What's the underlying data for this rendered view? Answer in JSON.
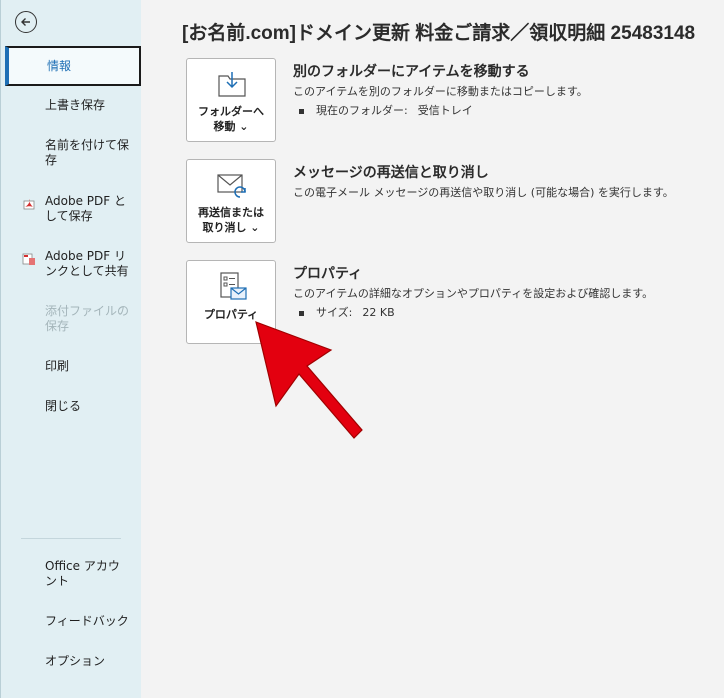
{
  "sidebar": {
    "items": [
      {
        "label": "情報"
      },
      {
        "label": "上書き保存"
      },
      {
        "label": "名前を付けて保存"
      },
      {
        "label": "Adobe PDF として保存"
      },
      {
        "label": "Adobe PDF リンクとして共有"
      },
      {
        "label": "添付ファイルの保存"
      },
      {
        "label": "印刷"
      },
      {
        "label": "閉じる"
      }
    ],
    "bottom_items": [
      {
        "label": "Office アカウント"
      },
      {
        "label": "フィードバック"
      },
      {
        "label": "オプション"
      }
    ]
  },
  "main": {
    "title": "[お名前.com]ドメイン更新 料金ご請求／領収明細 25483148",
    "sections": [
      {
        "button_line1": "フォルダーへ",
        "button_line2": "移動 ⌄",
        "title": "別のフォルダーにアイテムを移動する",
        "description": "このアイテムを別のフォルダーに移動またはコピーします。",
        "bullet_label": "現在のフォルダー:",
        "bullet_value": "受信トレイ"
      },
      {
        "button_line1": "再送信または",
        "button_line2": "取り消し ⌄",
        "title": "メッセージの再送信と取り消し",
        "description": "この電子メール メッセージの再送信や取り消し (可能な場合) を実行します。"
      },
      {
        "button_line1": "プロパティ",
        "title": "プロパティ",
        "description": "このアイテムの詳細なオプションやプロパティを設定および確認します。",
        "bullet_label": "サイズ:",
        "bullet_value": "22 KB"
      }
    ]
  },
  "colors": {
    "sidebar_bg": "#e1eff3",
    "accent": "#1e6fb5",
    "annotation_arrow": "#e3000f"
  }
}
